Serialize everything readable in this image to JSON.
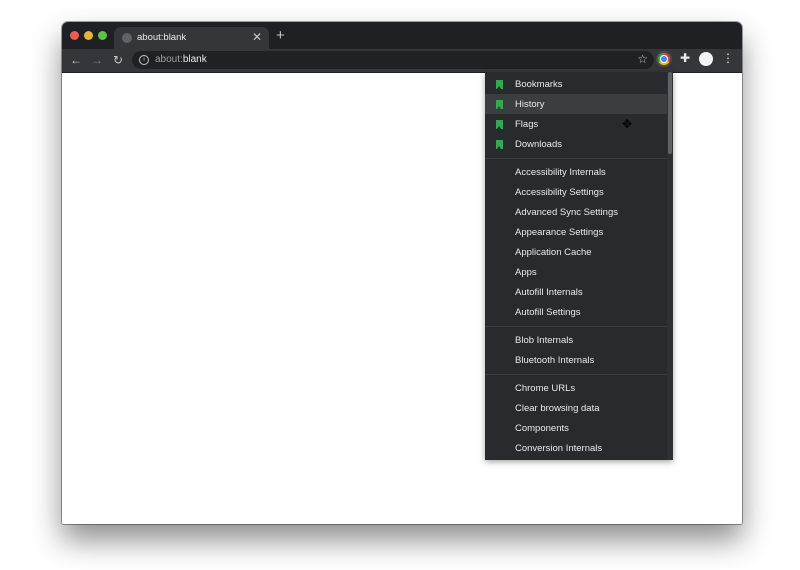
{
  "browser": {
    "tab": {
      "title": "about:blank",
      "close_glyph": "✕"
    },
    "new_tab_glyph": "+",
    "nav": {
      "back_glyph": "←",
      "forward_glyph": "→",
      "reload_glyph": "↻"
    },
    "omnibox": {
      "scheme": "about:",
      "host": "blank",
      "info_glyph": "i",
      "star_glyph": "☆"
    },
    "puzzle_glyph": "✚",
    "kebab_glyph": "⋮"
  },
  "menu": {
    "bookmarked": [
      {
        "label": "Bookmarks"
      },
      {
        "label": "History"
      },
      {
        "label": "Flags"
      },
      {
        "label": "Downloads"
      }
    ],
    "group_a": [
      {
        "label": "Accessibility Internals"
      },
      {
        "label": "Accessibility Settings"
      },
      {
        "label": "Advanced Sync Settings"
      },
      {
        "label": "Appearance Settings"
      },
      {
        "label": "Application Cache"
      },
      {
        "label": "Apps"
      },
      {
        "label": "Autofill Internals"
      },
      {
        "label": "Autofill Settings"
      }
    ],
    "group_b": [
      {
        "label": "Blob Internals"
      },
      {
        "label": "Bluetooth Internals"
      }
    ],
    "group_c": [
      {
        "label": "Chrome URLs"
      },
      {
        "label": "Clear browsing data"
      },
      {
        "label": "Components"
      },
      {
        "label": "Conversion Internals"
      }
    ],
    "hovered_item": "History"
  },
  "cursor_glyph": "✥",
  "colors": {
    "chrome_frame": "#1f2023",
    "toolbar": "#35363a",
    "menu_bg": "#292a2d",
    "bookmark_accent": "#34a853"
  }
}
